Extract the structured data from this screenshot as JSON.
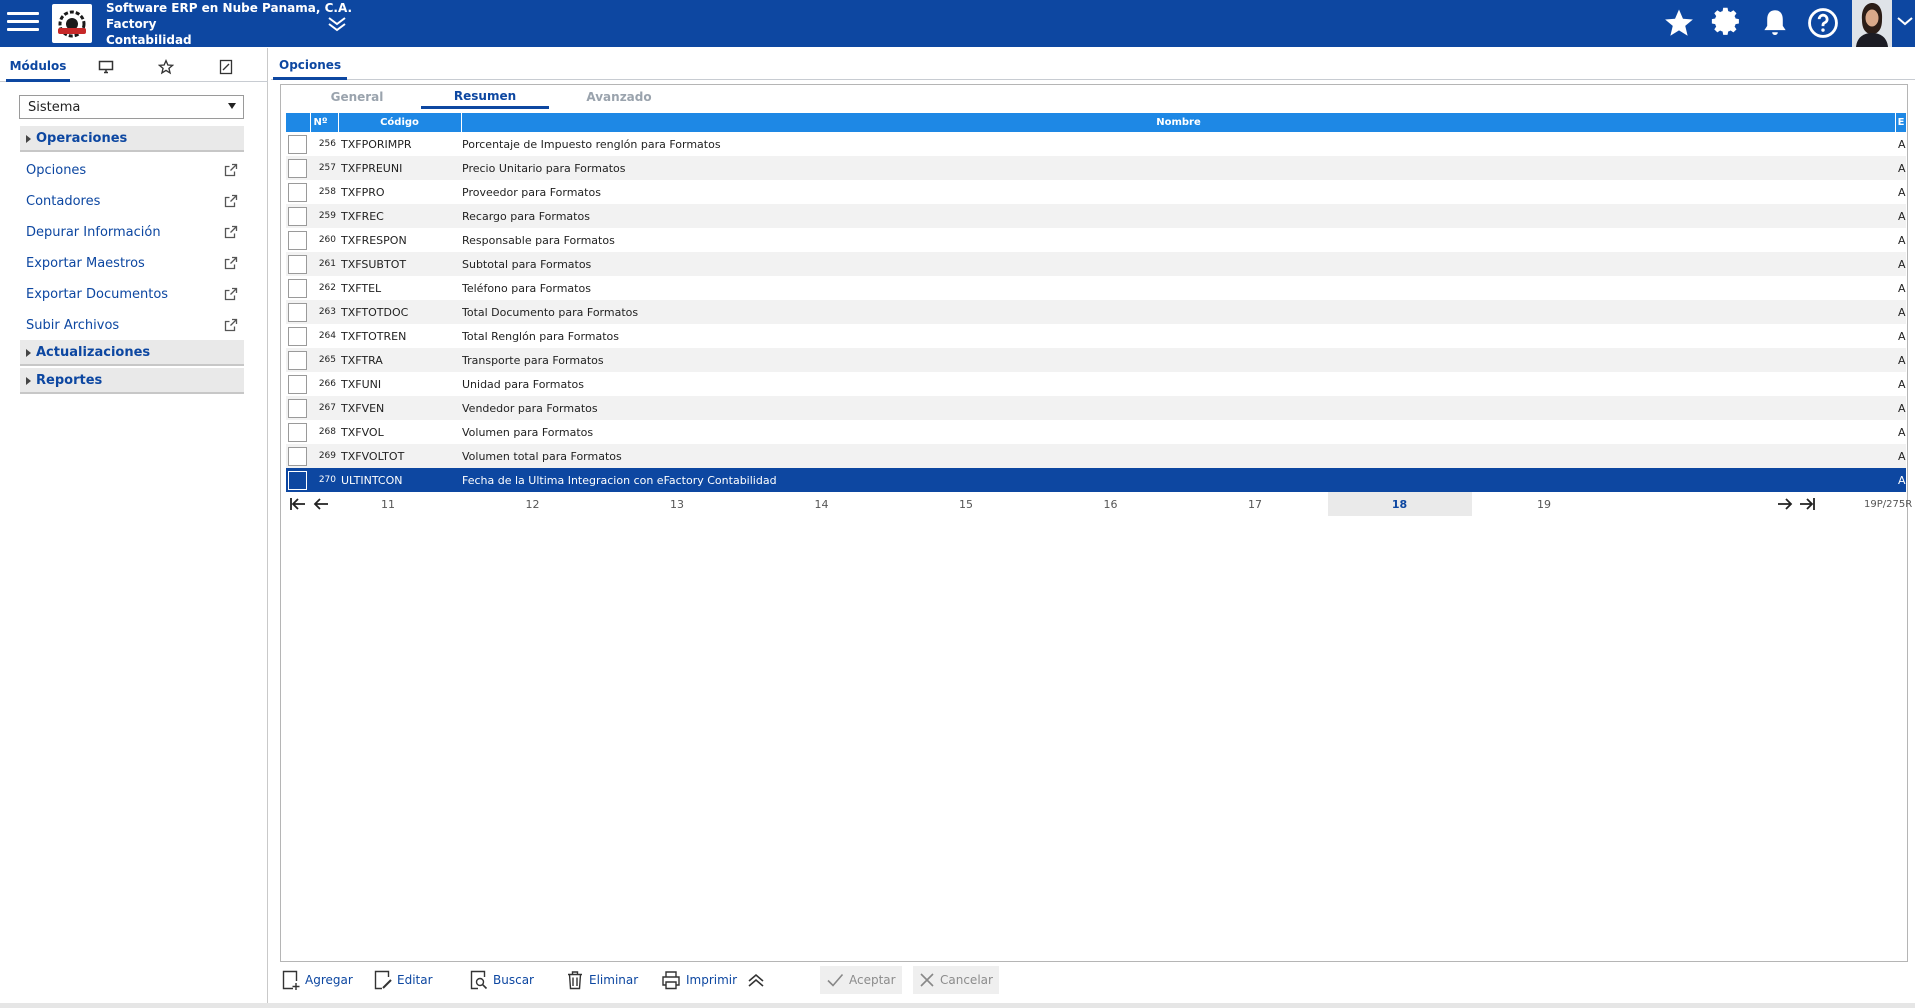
{
  "header": {
    "company_name": "Software ERP en Nube Panama, C.A.",
    "product": "Factory",
    "module": "Contabilidad",
    "icons": [
      "menu-icon",
      "star-icon",
      "gear-icon",
      "bell-icon",
      "help-icon"
    ],
    "brand_color": "#0d47a1"
  },
  "left_panel": {
    "tabs": {
      "modulos": "Módulos",
      "icons": [
        "monitor-icon",
        "star-outline-icon",
        "document-icon"
      ]
    },
    "module_select": {
      "selected": "Sistema"
    },
    "groups": {
      "operaciones": "Operaciones",
      "actualizaciones": "Actualizaciones",
      "reportes": "Reportes"
    },
    "items": [
      "Opciones",
      "Contadores",
      "Depurar Información",
      "Exportar Maestros",
      "Exportar Documentos",
      "Subir Archivos"
    ]
  },
  "content": {
    "tab": "Opciones",
    "subtabs": [
      "General",
      "Resumen",
      "Avanzado"
    ],
    "active_subtab": "Resumen",
    "table": {
      "columns": {
        "num": "Nº",
        "code": "Código",
        "name": "Nombre",
        "e": "E"
      },
      "rows": [
        {
          "num": "256",
          "code": "TXFPORIMPR",
          "name": "Porcentaje de Impuesto renglón para Formatos",
          "e": "A"
        },
        {
          "num": "257",
          "code": "TXFPREUNI",
          "name": "Precio Unitario para Formatos",
          "e": "A"
        },
        {
          "num": "258",
          "code": "TXFPRO",
          "name": "Proveedor para Formatos",
          "e": "A"
        },
        {
          "num": "259",
          "code": "TXFREC",
          "name": "Recargo para Formatos",
          "e": "A"
        },
        {
          "num": "260",
          "code": "TXFRESPON",
          "name": "Responsable para Formatos",
          "e": "A"
        },
        {
          "num": "261",
          "code": "TXFSUBTOT",
          "name": "Subtotal para Formatos",
          "e": "A"
        },
        {
          "num": "262",
          "code": "TXFTEL",
          "name": "Teléfono para Formatos",
          "e": "A"
        },
        {
          "num": "263",
          "code": "TXFTOTDOC",
          "name": "Total Documento para Formatos",
          "e": "A"
        },
        {
          "num": "264",
          "code": "TXFTOTREN",
          "name": "Total Renglón para Formatos",
          "e": "A"
        },
        {
          "num": "265",
          "code": "TXFTRA",
          "name": "Transporte para Formatos",
          "e": "A"
        },
        {
          "num": "266",
          "code": "TXFUNI",
          "name": "Unidad para Formatos",
          "e": "A"
        },
        {
          "num": "267",
          "code": "TXFVEN",
          "name": "Vendedor para Formatos",
          "e": "A"
        },
        {
          "num": "268",
          "code": "TXFVOL",
          "name": "Volumen para Formatos",
          "e": "A"
        },
        {
          "num": "269",
          "code": "TXFVOLTOT",
          "name": "Volumen total para Formatos",
          "e": "A"
        },
        {
          "num": "270",
          "code": "ULTINTCON",
          "name": "Fecha de la Ultima Integracion con eFactory Contabilidad",
          "e": "A"
        }
      ],
      "selected_row": "270"
    },
    "pager": {
      "pages": [
        "11",
        "12",
        "13",
        "14",
        "15",
        "16",
        "17",
        "18",
        "19"
      ],
      "current": "18",
      "info": "19P/275R"
    }
  },
  "toolbar": {
    "agregar": "Agregar",
    "editar": "Editar",
    "buscar": "Buscar",
    "eliminar": "Eliminar",
    "imprimir": "Imprimir",
    "aceptar": "Aceptar",
    "cancelar": "Cancelar"
  }
}
